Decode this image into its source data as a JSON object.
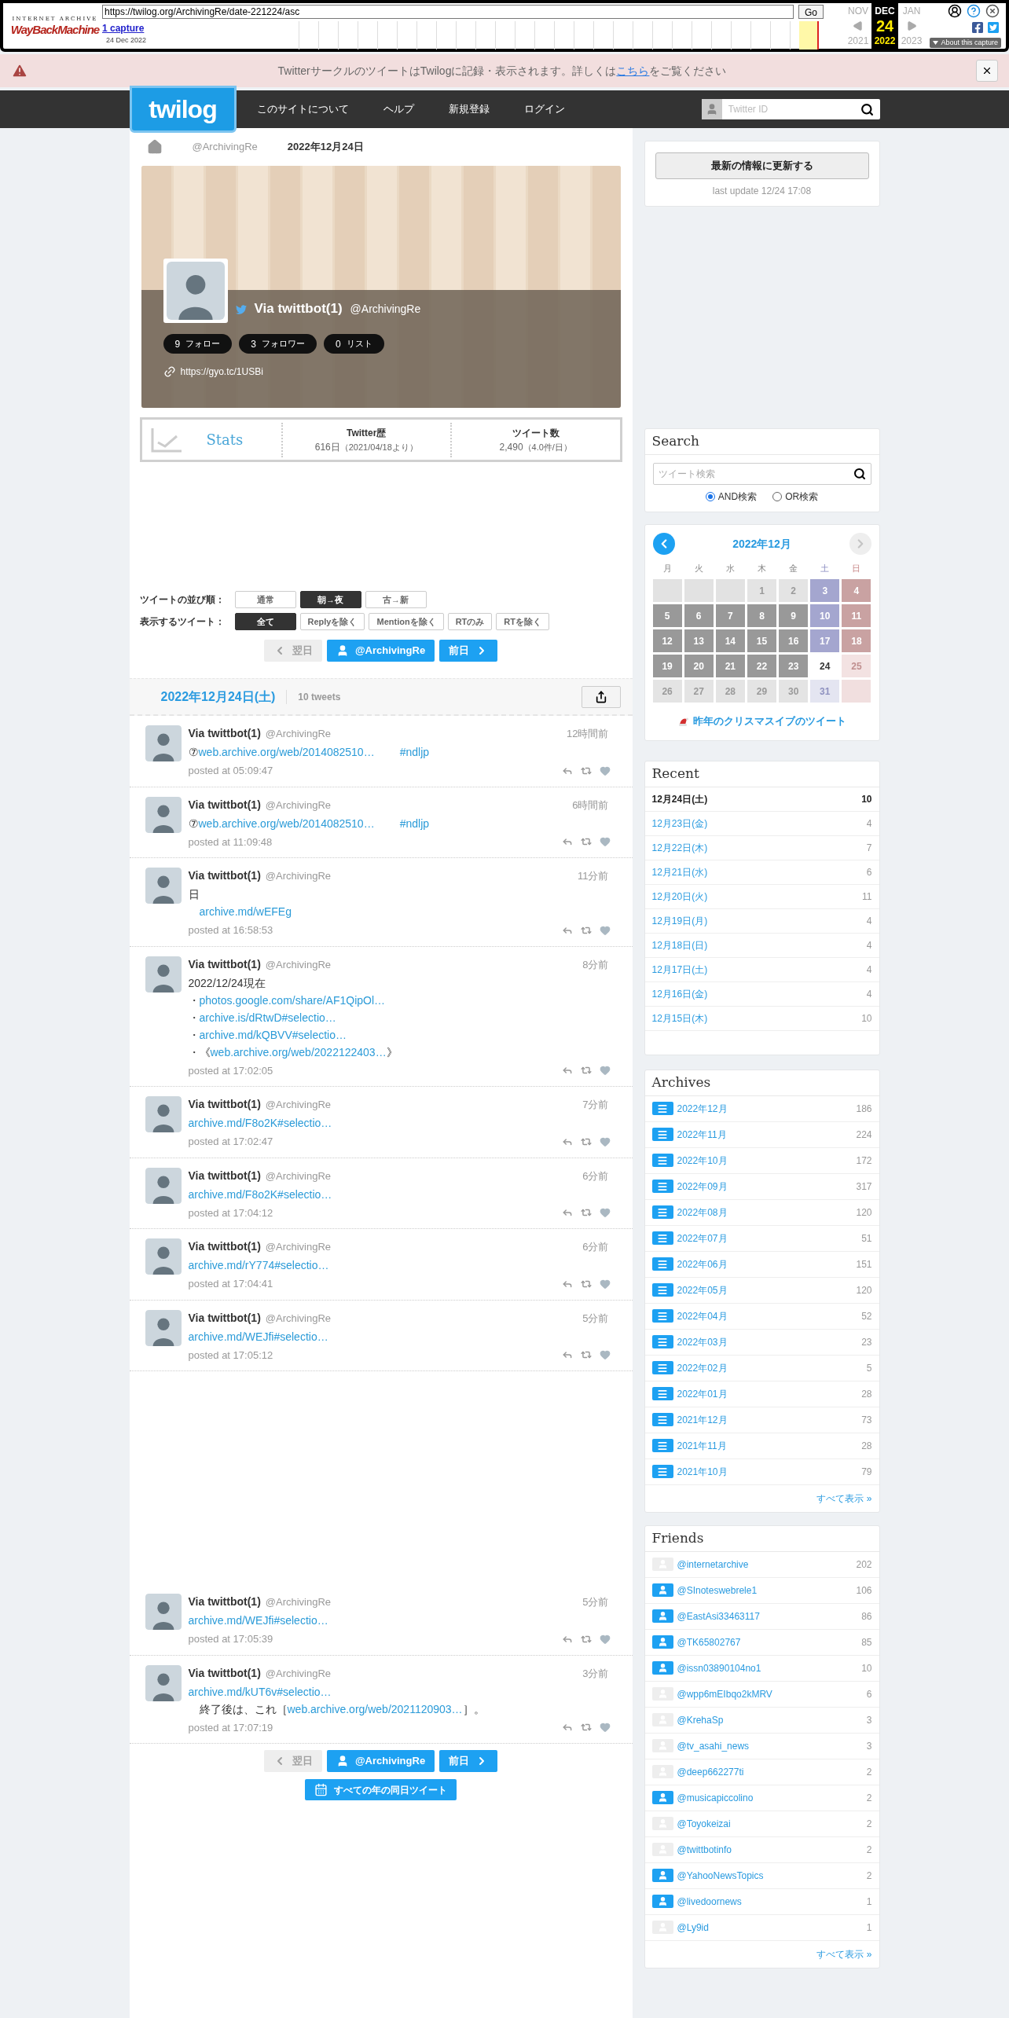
{
  "wayback": {
    "logo_top": "INTERNET ARCHIVE",
    "logo": "WayBackMachine",
    "url": "https://twilog.org/ArchivingRe/date-221224/asc",
    "go": "Go",
    "captures": "1 capture",
    "capture_date": "24 Dec 2022",
    "prev": {
      "month": "NOV",
      "year": "2021"
    },
    "current": {
      "month": "DEC",
      "day": "24",
      "year": "2022"
    },
    "next": {
      "month": "JAN",
      "year": "2023"
    },
    "about": "About this capture"
  },
  "notice": {
    "before": "TwitterサークルのツイートはTwilogに記録・表示されます。詳しくは",
    "link": "こちら",
    "after": "をご覧ください"
  },
  "nav": {
    "logo": "twilog",
    "items": [
      "このサイトについて",
      "ヘルプ",
      "新規登録",
      "ログイン"
    ],
    "search_placeholder": "Twitter ID"
  },
  "breadcrumb": [
    "@ArchivingRe",
    "2022年12月24日"
  ],
  "profile": {
    "name": "Via twittbot(1)",
    "handle": "@ArchivingRe",
    "counts": [
      {
        "value": "9",
        "label": "フォロー"
      },
      {
        "value": "3",
        "label": "フォロワー"
      },
      {
        "value": "0",
        "label": "リスト"
      }
    ],
    "url": "https://gyo.tc/1USBi"
  },
  "stats": {
    "title": "Stats",
    "items": [
      {
        "label": "Twitter歴",
        "value": "616日",
        "note": "（2021/04/18より）"
      },
      {
        "label": "ツイート数",
        "value": "2,490",
        "note": "（4.0件/日）"
      }
    ]
  },
  "filters": [
    {
      "label": "ツイートの並び順：",
      "options": [
        {
          "label": "通常",
          "selected": false
        },
        {
          "label": "朝→夜",
          "selected": true
        },
        {
          "label": "古→新",
          "selected": false
        }
      ]
    },
    {
      "label": "表示するツイート：",
      "options": [
        {
          "label": "全て",
          "selected": true
        },
        {
          "label": "Replyを除く",
          "selected": false
        },
        {
          "label": "Mentionを除く",
          "selected": false
        },
        {
          "label": "RTのみ",
          "selected": false
        },
        {
          "label": "RTを除く",
          "selected": false
        }
      ]
    }
  ],
  "day_nav_top": [
    {
      "kind": "prev",
      "label": "翌日",
      "disabled": true
    },
    {
      "kind": "user",
      "label": "@ArchivingRe",
      "disabled": false
    },
    {
      "kind": "next",
      "label": "前日",
      "disabled": false
    }
  ],
  "day_header": {
    "date": "2022年12月24日(土)",
    "count": "10 tweets"
  },
  "tweet_groups": [
    [
      {
        "name": "Via twittbot(1)",
        "handle": "@ArchivingRe",
        "ago": "12時間前",
        "body": [
          [
            {
              "text": "⑦",
              "link": false
            },
            {
              "text": "web.archive.org/web/2014082510…",
              "link": true
            },
            {
              "text": "#ndljp",
              "link": true
            }
          ]
        ],
        "posted": "posted at 05:09:47"
      },
      {
        "name": "Via twittbot(1)",
        "handle": "@ArchivingRe",
        "ago": "6時間前",
        "body": [
          [
            {
              "text": "⑦",
              "link": false
            },
            {
              "text": "web.archive.org/web/2014082510…",
              "link": true
            },
            {
              "text": "#ndljp",
              "link": true
            }
          ]
        ],
        "posted": "posted at 11:09:48"
      },
      {
        "name": "Via twittbot(1)",
        "handle": "@ArchivingRe",
        "ago": "11分前",
        "body": [
          [
            {
              "text": "日",
              "link": false
            }
          ],
          [
            {
              "text": "archive.md/wEFEg",
              "link": true
            }
          ]
        ],
        "posted": "posted at 16:58:53"
      },
      {
        "name": "Via twittbot(1)",
        "handle": "@ArchivingRe",
        "ago": "8分前",
        "body": [
          [
            {
              "text": "2022/12/24現在",
              "link": false
            }
          ],
          [
            {
              "text": "・",
              "link": false
            },
            {
              "text": "photos.google.com/share/AF1QipOl…",
              "link": true
            }
          ],
          [
            {
              "text": "・",
              "link": false
            },
            {
              "text": "archive.is/dRtwD#selectio…",
              "link": true
            }
          ],
          [
            {
              "text": "・",
              "link": false
            },
            {
              "text": "archive.md/kQBVV#selectio…",
              "link": true
            }
          ],
          [
            {
              "text": "・《",
              "link": false
            },
            {
              "text": "web.archive.org/web/2022122403…",
              "link": true
            },
            {
              "text": "》",
              "link": false
            }
          ]
        ],
        "posted": "posted at 17:02:05"
      },
      {
        "name": "Via twittbot(1)",
        "handle": "@ArchivingRe",
        "ago": "7分前",
        "body": [
          [
            {
              "text": "archive.md/F8o2K#selectio…",
              "link": true
            }
          ]
        ],
        "posted": "posted at 17:02:47"
      },
      {
        "name": "Via twittbot(1)",
        "handle": "@ArchivingRe",
        "ago": "6分前",
        "body": [
          [
            {
              "text": "archive.md/F8o2K#selectio…",
              "link": true
            }
          ]
        ],
        "posted": "posted at 17:04:12"
      },
      {
        "name": "Via twittbot(1)",
        "handle": "@ArchivingRe",
        "ago": "6分前",
        "body": [
          [
            {
              "text": "archive.md/rY774#selectio…",
              "link": true
            }
          ]
        ],
        "posted": "posted at 17:04:41"
      },
      {
        "name": "Via twittbot(1)",
        "handle": "@ArchivingRe",
        "ago": "5分前",
        "body": [
          [
            {
              "text": "archive.md/WEJfi#selectio…",
              "link": true
            }
          ]
        ],
        "posted": "posted at 17:05:12"
      }
    ],
    [
      {
        "name": "Via twittbot(1)",
        "handle": "@ArchivingRe",
        "ago": "5分前",
        "body": [
          [
            {
              "text": "archive.md/WEJfi#selectio…",
              "link": true
            }
          ]
        ],
        "posted": "posted at 17:05:39"
      },
      {
        "name": "Via twittbot(1)",
        "handle": "@ArchivingRe",
        "ago": "3分前",
        "body": [
          [
            {
              "text": "archive.md/kUT6v#selectio…",
              "link": true
            }
          ],
          [
            {
              "text": "終了後は、これ［",
              "link": false
            },
            {
              "text": "web.archive.org/web/2021120903…",
              "link": true
            },
            {
              "text": "］。",
              "link": false
            }
          ]
        ],
        "posted": "posted at 17:07:19"
      }
    ]
  ],
  "day_nav_bottom": [
    {
      "kind": "prev",
      "label": "翌日",
      "disabled": true
    },
    {
      "kind": "user",
      "label": "@ArchivingRe",
      "disabled": false
    },
    {
      "kind": "next",
      "label": "前日",
      "disabled": false
    }
  ],
  "all_years": "すべての年の同日ツイート",
  "update": {
    "button": "最新の情報に更新する",
    "last": "last update 12/24 17:08"
  },
  "search": {
    "title": "Search",
    "placeholder": "ツイート検索",
    "modes": [
      {
        "label": "AND検索",
        "selected": true
      },
      {
        "label": "OR検索",
        "selected": false
      }
    ]
  },
  "calendar": {
    "title": "2022年12月",
    "prev_disabled": false,
    "next_disabled": true,
    "weekdays": [
      "月",
      "火",
      "水",
      "木",
      "金",
      "土",
      "日"
    ],
    "days": [
      {
        "kind": "blank"
      },
      {
        "kind": "blank"
      },
      {
        "kind": "blank"
      },
      {
        "day": "1",
        "kind": "none"
      },
      {
        "day": "2",
        "kind": "none"
      },
      {
        "day": "3",
        "kind": "tweets"
      },
      {
        "day": "4",
        "kind": "tweets"
      },
      {
        "day": "5",
        "kind": "tweets"
      },
      {
        "day": "6",
        "kind": "tweets"
      },
      {
        "day": "7",
        "kind": "tweets"
      },
      {
        "day": "8",
        "kind": "tweets"
      },
      {
        "day": "9",
        "kind": "tweets"
      },
      {
        "day": "10",
        "kind": "tweets"
      },
      {
        "day": "11",
        "kind": "tweets"
      },
      {
        "day": "12",
        "kind": "tweets"
      },
      {
        "day": "13",
        "kind": "tweets"
      },
      {
        "day": "14",
        "kind": "tweets"
      },
      {
        "day": "15",
        "kind": "tweets"
      },
      {
        "day": "16",
        "kind": "tweets"
      },
      {
        "day": "17",
        "kind": "tweets"
      },
      {
        "day": "18",
        "kind": "tweets"
      },
      {
        "day": "19",
        "kind": "tweets"
      },
      {
        "day": "20",
        "kind": "tweets"
      },
      {
        "day": "21",
        "kind": "tweets"
      },
      {
        "day": "22",
        "kind": "tweets"
      },
      {
        "day": "23",
        "kind": "tweets"
      },
      {
        "day": "24",
        "kind": "selected"
      },
      {
        "day": "25",
        "kind": "none"
      },
      {
        "day": "26",
        "kind": "none"
      },
      {
        "day": "27",
        "kind": "none"
      },
      {
        "day": "28",
        "kind": "none"
      },
      {
        "day": "29",
        "kind": "none"
      },
      {
        "day": "30",
        "kind": "none"
      },
      {
        "day": "31",
        "kind": "none"
      },
      {
        "kind": "blank"
      }
    ],
    "link": "昨年のクリスマスイブのツイート"
  },
  "recent": {
    "title": "Recent",
    "items": [
      {
        "label": "12月24日(土)",
        "count": "10",
        "selected": true
      },
      {
        "label": "12月23日(金)",
        "count": "4",
        "selected": false
      },
      {
        "label": "12月22日(木)",
        "count": "7",
        "selected": false
      },
      {
        "label": "12月21日(水)",
        "count": "6",
        "selected": false
      },
      {
        "label": "12月20日(火)",
        "count": "11",
        "selected": false
      },
      {
        "label": "12月19日(月)",
        "count": "4",
        "selected": false
      },
      {
        "label": "12月18日(日)",
        "count": "4",
        "selected": false
      },
      {
        "label": "12月17日(土)",
        "count": "4",
        "selected": false
      },
      {
        "label": "12月16日(金)",
        "count": "4",
        "selected": false
      },
      {
        "label": "12月15日(木)",
        "count": "10",
        "selected": false
      }
    ]
  },
  "archives": {
    "title": "Archives",
    "items": [
      {
        "label": "2022年12月",
        "count": "186"
      },
      {
        "label": "2022年11月",
        "count": "224"
      },
      {
        "label": "2022年10月",
        "count": "172"
      },
      {
        "label": "2022年09月",
        "count": "317"
      },
      {
        "label": "2022年08月",
        "count": "120"
      },
      {
        "label": "2022年07月",
        "count": "51"
      },
      {
        "label": "2022年06月",
        "count": "151"
      },
      {
        "label": "2022年05月",
        "count": "120"
      },
      {
        "label": "2022年04月",
        "count": "52"
      },
      {
        "label": "2022年03月",
        "count": "23"
      },
      {
        "label": "2022年02月",
        "count": "5"
      },
      {
        "label": "2022年01月",
        "count": "28"
      },
      {
        "label": "2021年12月",
        "count": "73"
      },
      {
        "label": "2021年11月",
        "count": "28"
      },
      {
        "label": "2021年10月",
        "count": "79"
      }
    ],
    "more": "すべて表示 »"
  },
  "friends": {
    "title": "Friends",
    "items": [
      {
        "handle": "@internetarchive",
        "count": "202",
        "color": "#eeeeee"
      },
      {
        "handle": "@SInoteswebrele1",
        "count": "106",
        "color": "#1da1f2"
      },
      {
        "handle": "@EastAsi33463117",
        "count": "86",
        "color": "#1da1f2"
      },
      {
        "handle": "@TK65802767",
        "count": "85",
        "color": "#1da1f2"
      },
      {
        "handle": "@issn03890104no1",
        "count": "10",
        "color": "#1da1f2"
      },
      {
        "handle": "@wpp6mEIbqo2kMRV",
        "count": "6",
        "color": "#eeeeee"
      },
      {
        "handle": "@KrehaSp",
        "count": "3",
        "color": "#eeeeee"
      },
      {
        "handle": "@tv_asahi_news",
        "count": "3",
        "color": "#eeeeee"
      },
      {
        "handle": "@deep662277ti",
        "count": "2",
        "color": "#eeeeee"
      },
      {
        "handle": "@musicapiccolino",
        "count": "2",
        "color": "#1da1f2"
      },
      {
        "handle": "@Toyokeizai",
        "count": "2",
        "color": "#eeeeee"
      },
      {
        "handle": "@twittbotinfo",
        "count": "2",
        "color": "#eeeeee"
      },
      {
        "handle": "@YahooNewsTopics",
        "count": "2",
        "color": "#1da1f2"
      },
      {
        "handle": "@livedoornews",
        "count": "1",
        "color": "#1da1f2"
      },
      {
        "handle": "@Ly9id",
        "count": "1",
        "color": "#eeeeee"
      }
    ],
    "more": "すべて表示 »"
  }
}
